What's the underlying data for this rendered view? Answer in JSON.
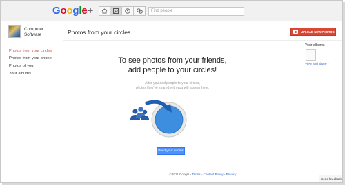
{
  "topbar": {
    "logo": {
      "part1": "G",
      "part2": "o",
      "part3": "o",
      "part4": "g",
      "part5": "l",
      "part6": "e",
      "plus": "+"
    },
    "search_placeholder": "Find people",
    "nav_icons": [
      "home-icon",
      "photos-icon",
      "profile-icon",
      "circles-icon"
    ]
  },
  "profile": {
    "name": "Computer Software"
  },
  "sidebar": {
    "items": [
      {
        "label": "Photos from your circles",
        "active": true
      },
      {
        "label": "Photos from your phone",
        "active": false
      },
      {
        "label": "Photos of you",
        "active": false
      },
      {
        "label": "Your albums",
        "active": false
      }
    ]
  },
  "main": {
    "title": "Photos from your circles",
    "upload_label": "UPLOAD NEW PHOTOS",
    "headline_line1": "To see photos from your friends,",
    "headline_line2": "add people to your circles!",
    "sub_line1": "After you add people to your circles,",
    "sub_line2": "photos they've shared with you will appear here.",
    "build_label": "Build your circles"
  },
  "albums": {
    "label": "Your albums",
    "link": "View and share ›"
  },
  "footer": {
    "copyright": "©2011 Google - ",
    "terms": "Terms",
    "sep1": " - ",
    "policy": "Content Policy",
    "sep2": " - ",
    "privacy": "Privacy"
  },
  "feedback_label": "Send feedback",
  "colors": {
    "accent_red": "#d64937",
    "link_blue": "#3366cc",
    "button_blue": "#4d90fe",
    "circle_blue": "#3d8ede"
  }
}
